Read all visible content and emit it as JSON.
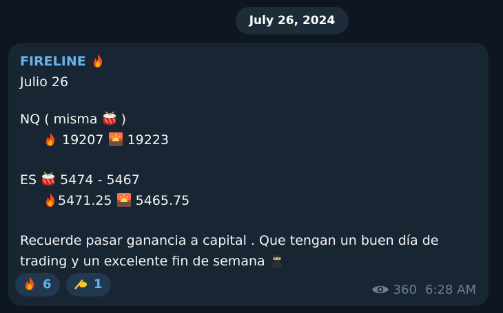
{
  "date_separator": "July 26, 2024",
  "message": {
    "sender": "FIRELINE",
    "lines": {
      "l1": "Julio 26",
      "nq_label": "NQ  ( misma",
      "nq_close": ")",
      "nq_fire_value": "19207",
      "nq_sunrise_value": "19223",
      "es_label": "ES",
      "es_range": "5474 - 5467",
      "es_fire_value": "5471.25",
      "es_sunrise_value": "5465.75",
      "closing_1": "Recuerde pasar ganancia a capital . Que tengan un buen día de",
      "closing_2": "trading y un excelente fin de semana"
    },
    "icons": {
      "sender_icon": "fire-emoji",
      "drum": "drum-emoji",
      "fire": "fire-emoji",
      "sunrise": "sunrise-emoji",
      "ninja": "ninja-emoji"
    },
    "reactions": [
      {
        "emoji": "fire-emoji",
        "count": "6"
      },
      {
        "emoji": "writing-hand-emoji",
        "count": "1"
      }
    ],
    "views": "360",
    "time": "6:28 AM"
  },
  "colors": {
    "background": "#0e1621",
    "bubble": "#182533",
    "sender": "#64b5ef",
    "text": "#f5f5f5",
    "meta": "#6d7f8f",
    "reaction_bg": "#21384f"
  }
}
